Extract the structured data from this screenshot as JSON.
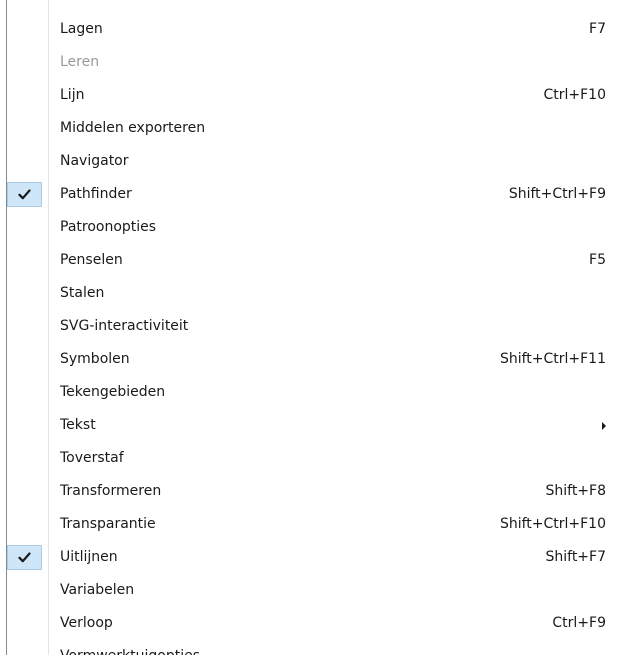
{
  "menu": {
    "items": [
      {
        "label": "Lagen",
        "shortcut": "F7",
        "checked": false,
        "disabled": false,
        "submenu": false
      },
      {
        "label": "Leren",
        "shortcut": "",
        "checked": false,
        "disabled": true,
        "submenu": false
      },
      {
        "label": "Lijn",
        "shortcut": "Ctrl+F10",
        "checked": false,
        "disabled": false,
        "submenu": false
      },
      {
        "label": "Middelen exporteren",
        "shortcut": "",
        "checked": false,
        "disabled": false,
        "submenu": false
      },
      {
        "label": "Navigator",
        "shortcut": "",
        "checked": false,
        "disabled": false,
        "submenu": false
      },
      {
        "label": "Pathfinder",
        "shortcut": "Shift+Ctrl+F9",
        "checked": true,
        "disabled": false,
        "submenu": false
      },
      {
        "label": "Patroonopties",
        "shortcut": "",
        "checked": false,
        "disabled": false,
        "submenu": false
      },
      {
        "label": "Penselen",
        "shortcut": "F5",
        "checked": false,
        "disabled": false,
        "submenu": false
      },
      {
        "label": "Stalen",
        "shortcut": "",
        "checked": false,
        "disabled": false,
        "submenu": false
      },
      {
        "label": "SVG-interactiviteit",
        "shortcut": "",
        "checked": false,
        "disabled": false,
        "submenu": false
      },
      {
        "label": "Symbolen",
        "shortcut": "Shift+Ctrl+F11",
        "checked": false,
        "disabled": false,
        "submenu": false
      },
      {
        "label": "Tekengebieden",
        "shortcut": "",
        "checked": false,
        "disabled": false,
        "submenu": false
      },
      {
        "label": "Tekst",
        "shortcut": "",
        "checked": false,
        "disabled": false,
        "submenu": true
      },
      {
        "label": "Toverstaf",
        "shortcut": "",
        "checked": false,
        "disabled": false,
        "submenu": false
      },
      {
        "label": "Transformeren",
        "shortcut": "Shift+F8",
        "checked": false,
        "disabled": false,
        "submenu": false
      },
      {
        "label": "Transparantie",
        "shortcut": "Shift+Ctrl+F10",
        "checked": false,
        "disabled": false,
        "submenu": false
      },
      {
        "label": "Uitlijnen",
        "shortcut": "Shift+F7",
        "checked": true,
        "disabled": false,
        "submenu": false
      },
      {
        "label": "Variabelen",
        "shortcut": "",
        "checked": false,
        "disabled": false,
        "submenu": false
      },
      {
        "label": "Verloop",
        "shortcut": "Ctrl+F9",
        "checked": false,
        "disabled": false,
        "submenu": false
      }
    ],
    "partial_item": {
      "label": "Vormwerktuigopties"
    }
  },
  "icons": {
    "check": "checkmark-icon",
    "submenu": "submenu-arrow-icon"
  },
  "colors": {
    "check_highlight": "#cfe6f8",
    "check_border": "#a9cde9",
    "check_mark": "#1a1a1a",
    "disabled_text": "#9a9a9a",
    "text": "#1a1a1a"
  }
}
